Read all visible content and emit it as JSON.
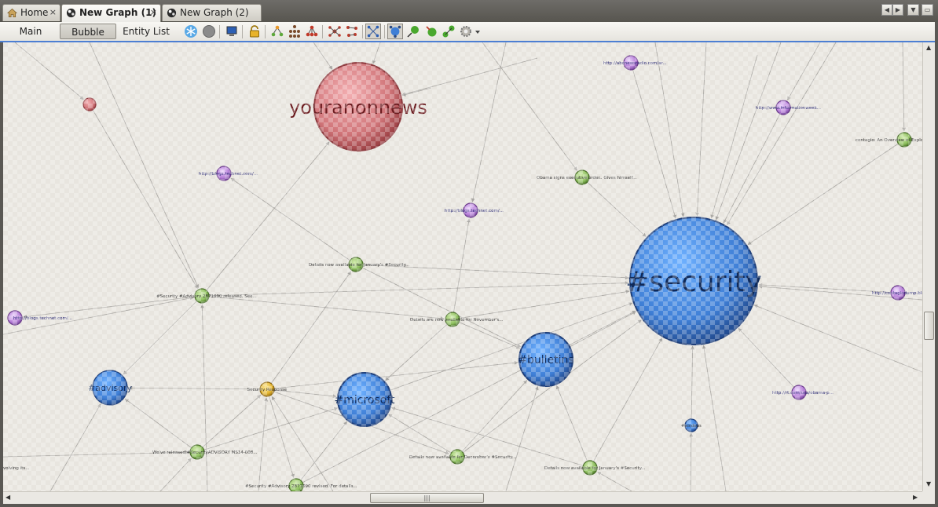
{
  "tabs": [
    {
      "label": "Home",
      "active": false,
      "icon": "home-icon"
    },
    {
      "label": "New Graph (1)",
      "active": true,
      "icon": "graph-icon"
    },
    {
      "label": "New Graph (2)",
      "active": false,
      "icon": "graph-icon"
    }
  ],
  "tab_close_glyph": "×",
  "view_buttons": {
    "main": "Main View",
    "bubble": "Bubble View",
    "entity": "Entity List"
  },
  "selected_view": "Bubble View",
  "toolbar_icons": [
    "snowflake-icon",
    "circle-icon",
    "monitor-icon",
    "lock-icon",
    "hierarchy-layout-icon",
    "tree-layout-icon",
    "block-layout-icon",
    "organic-layout-icon",
    "node-spread-icon",
    "interactive-layout-icon",
    "bubble-size-icon",
    "green-node-arrow-icon",
    "green-node-add-icon",
    "green-node-link-icon",
    "settings-gear-icon"
  ],
  "colors": {
    "hashtag_blue": "#3f7fd6",
    "user_red": "#d1767a",
    "tweet_green": "#8fc060",
    "url_purple": "#b77fd8",
    "highlight_yellow": "#e5b732",
    "accent_blue": "#4d7fd3"
  },
  "graph": {
    "nodes": [
      {
        "id": "youranonnews",
        "type": "user",
        "label": "youranonnews"
      },
      {
        "id": "security",
        "type": "hashtag",
        "label": "#security"
      },
      {
        "id": "bulletins",
        "type": "hashtag",
        "label": "#bulletins"
      },
      {
        "id": "microsoft",
        "type": "hashtag",
        "label": "#microsoft"
      },
      {
        "id": "advisory",
        "type": "hashtag",
        "label": "#advisory"
      },
      {
        "id": "smallblue",
        "type": "hashtag",
        "label": "#windows"
      },
      {
        "id": "security_response",
        "type": "selected",
        "label": "Security Response"
      },
      {
        "id": "u1",
        "type": "url",
        "label": "http://abcnewsradio.com/ar..."
      },
      {
        "id": "u2",
        "type": "url",
        "label": "http://www.informationweek..."
      },
      {
        "id": "u3",
        "type": "url",
        "label": "http://blogs.technet.com/..."
      },
      {
        "id": "u4",
        "type": "url",
        "label": "http://blogs.technet.com/..."
      },
      {
        "id": "u5",
        "type": "url",
        "label": "http://blogs.technet.com/..."
      },
      {
        "id": "u6",
        "type": "url",
        "label": "http://contagiodump.blog..."
      },
      {
        "id": "u7",
        "type": "url",
        "label": "http://rt.com/usa/obama-p..."
      },
      {
        "id": "t1",
        "type": "tweet",
        "label": "Obama signs executive order.. Gives himself..."
      },
      {
        "id": "t2",
        "type": "tweet",
        "label": "contagio: An Overview of Exploit..."
      },
      {
        "id": "t3",
        "type": "tweet",
        "label": "Details now available for January's #Security..."
      },
      {
        "id": "t4",
        "type": "tweet",
        "label": "#Security #Advisory 2871690 released. See..."
      },
      {
        "id": "t5",
        "type": "tweet",
        "label": "Details are now available for November's..."
      },
      {
        "id": "t6",
        "type": "tweet",
        "label": "We've released #SecurityADVISORY MS14-008..."
      },
      {
        "id": "t7",
        "type": "tweet",
        "label": "Details now available for December's #Security..."
      },
      {
        "id": "t8",
        "type": "tweet",
        "label": "Details now available for January's #Security..."
      },
      {
        "id": "t9",
        "type": "tweet",
        "label": "#Security #Advisory 2871690 revised. For details..."
      },
      {
        "id": "ghost",
        "type": "user",
        "label": ""
      }
    ],
    "partial_labels": [
      "volving its..."
    ]
  }
}
